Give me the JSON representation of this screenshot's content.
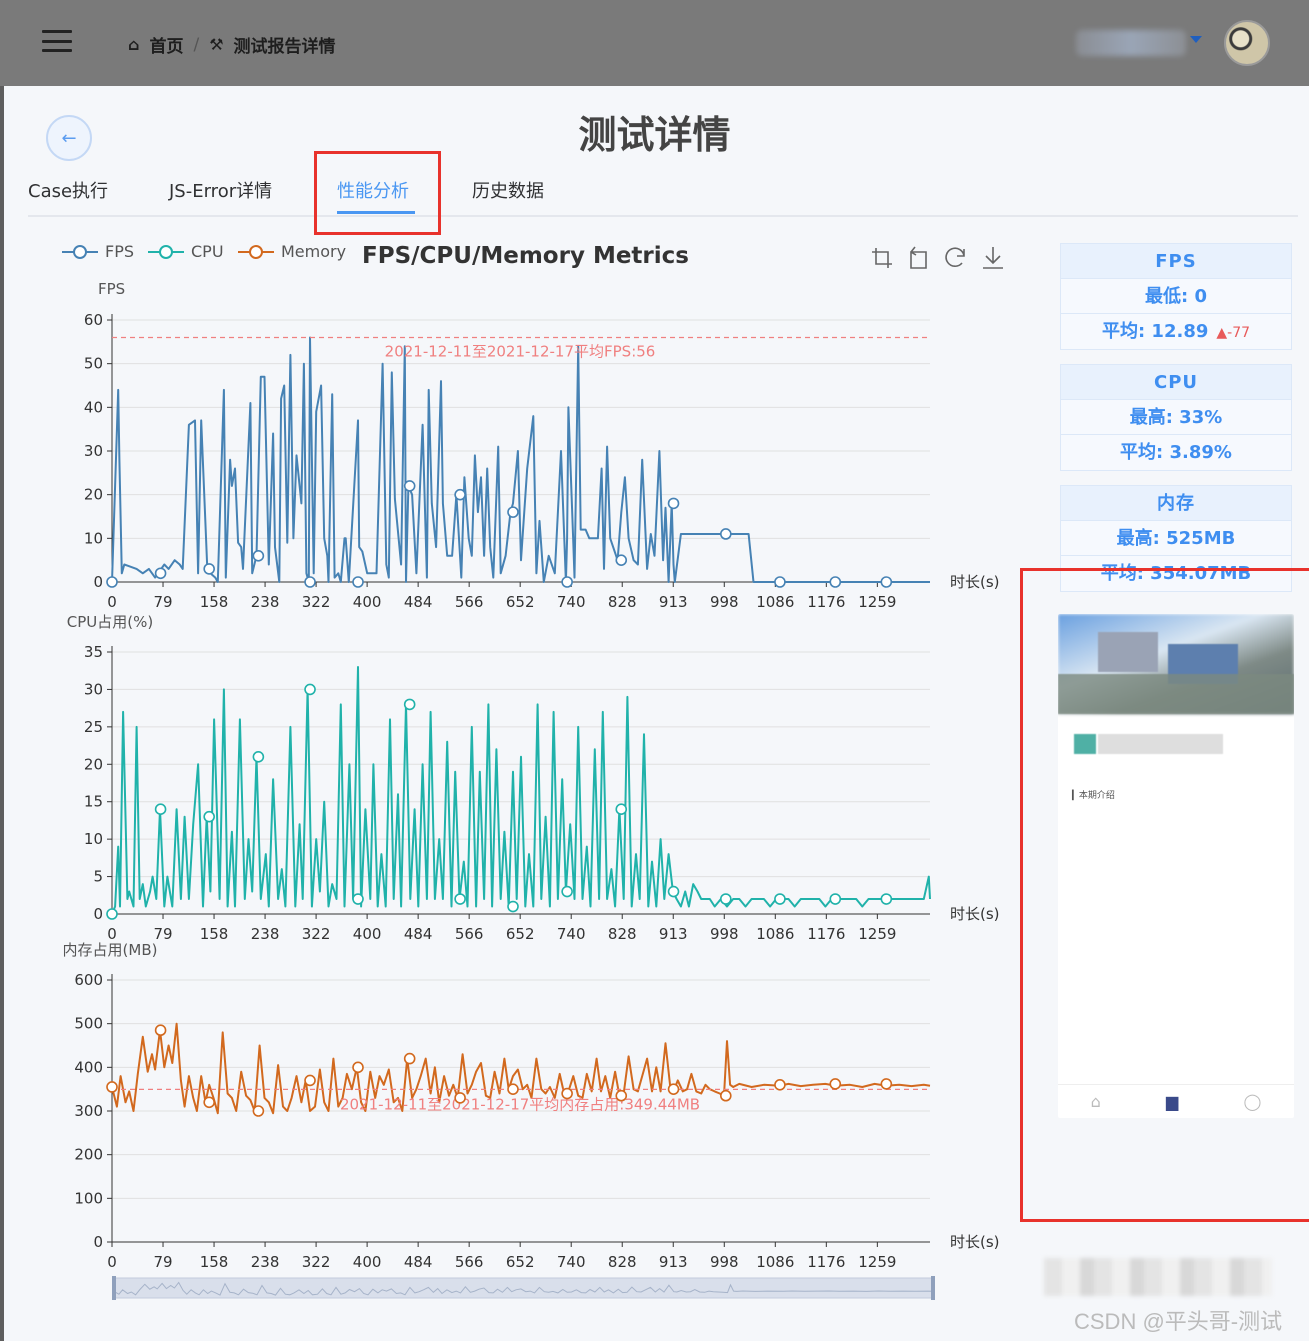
{
  "topbar": {
    "breadcrumbs": [
      {
        "icon": "home-icon",
        "glyph": "⌂",
        "label": "首页"
      },
      {
        "icon": "tools-icon",
        "glyph": "⚒",
        "label": "测试报告详情"
      }
    ],
    "separator": "/"
  },
  "page": {
    "back_glyph": "←",
    "title": "测试详情",
    "tabs": [
      "Case执行",
      "JS-Error详情",
      "性能分析",
      "历史数据"
    ],
    "active_tab": 2
  },
  "stats": {
    "fps": {
      "title": "FPS",
      "min": "最低: 0",
      "avg": "平均: 12.89",
      "trend": "▲-77"
    },
    "cpu": {
      "title": "CPU",
      "max": "最高: 33%",
      "avg": "平均: 3.89%"
    },
    "mem": {
      "title": "内存",
      "max": "最高: 525MB",
      "avg": "平均: 354.07MB"
    }
  },
  "preview": {
    "label": "▎本期介绍"
  },
  "watermark": "CSDN @平头哥-测试",
  "colors": {
    "fps": "#4682b4",
    "cpu": "#20b2aa",
    "mem": "#d2691e",
    "active": "#4a97f2",
    "highlight": "#e8322c",
    "avg_line": "#f08080"
  },
  "chart_data": {
    "type": "line",
    "title": "FPS/CPU/Memory Metrics",
    "legend": [
      "FPS",
      "CPU",
      "Memory"
    ],
    "legend_position": "top-left",
    "x_categories": [
      "0",
      "79",
      "158",
      "238",
      "322",
      "400",
      "484",
      "566",
      "652",
      "740",
      "828",
      "913",
      "998",
      "1086",
      "1176",
      "1259"
    ],
    "x_range": [
      0,
      1330
    ],
    "xlabel": "时长(s)",
    "panels": [
      {
        "name": "FPS",
        "ylabel": "FPS",
        "ylim": [
          0,
          60
        ],
        "yticks": [
          "0",
          "10",
          "20",
          "30",
          "40",
          "50",
          "60"
        ],
        "avg_value": 56,
        "avg_label": "2021-12-11至2021-12-17平均FPS:56",
        "x": [
          0,
          10,
          12,
          16,
          20,
          40,
          50,
          60,
          70,
          75,
          85,
          92,
          102,
          110,
          115,
          125,
          135,
          140,
          145,
          155,
          160,
          168,
          172,
          182,
          185,
          192,
          195,
          200,
          205,
          210,
          213,
          225,
          228,
          235,
          242,
          248,
          255,
          262,
          265,
          272,
          275,
          280,
          285,
          290,
          295,
          300,
          308,
          312,
          316,
          320,
          322,
          328,
          332,
          340,
          345,
          350,
          352,
          358,
          362,
          368,
          372,
          378,
          380,
          385,
          400,
          402,
          407,
          415,
          430,
          440,
          446,
          450,
          455,
          460,
          470,
          476,
          478,
          482,
          488,
          495,
          505,
          512,
          515,
          520,
          527,
          535,
          538,
          545,
          553,
          560,
          568,
          573,
          580,
          585,
          590,
          595,
          600,
          605,
          610,
          615,
          620,
          628,
          632,
          640,
          648,
          652,
          660,
          665,
          675,
          685,
          690,
          695,
          702,
          710,
          720,
          730,
          738,
          740,
          742,
          750,
          752,
          758,
          762,
          765,
          768,
          770,
          776,
          780,
          790,
          796,
          800,
          805,
          810,
          822,
          828,
          834,
          840,
          848,
          855,
          862,
          870,
          876,
          882,
          890,
          896,
          900,
          905,
          910,
          913,
          915,
          925,
          930,
          945,
          960,
          970,
          985,
          990,
          995,
          998,
          1000,
          1005,
          1010,
          1015,
          1025,
          1035,
          1043,
          1045,
          1086,
          1176,
          1259,
          1328,
          1330
        ],
        "y": [
          0,
          44,
          28,
          2,
          4,
          3,
          2,
          3,
          1,
          2,
          4,
          3,
          5,
          4,
          3,
          36,
          37,
          2,
          37,
          3,
          2,
          1,
          0,
          44,
          1,
          28,
          22,
          26,
          9,
          8,
          3,
          41,
          2,
          6,
          47,
          47,
          4,
          34,
          8,
          0,
          42,
          45,
          9,
          52,
          10,
          29,
          18,
          50,
          2,
          0,
          56,
          2,
          39,
          45,
          10,
          6,
          0,
          43,
          1,
          2,
          0,
          10,
          10,
          0,
          37,
          8,
          7,
          2,
          2,
          50,
          4,
          1,
          48,
          19,
          4,
          54,
          0,
          22,
          20,
          2,
          36,
          1,
          44,
          18,
          8,
          46,
          18,
          6,
          6,
          20,
          1,
          24,
          10,
          6,
          29,
          16,
          24,
          6,
          26,
          8,
          1,
          31,
          2,
          6,
          16,
          18,
          30,
          5,
          26,
          38,
          2,
          14,
          0,
          6,
          2,
          30,
          0,
          10,
          40,
          9,
          1,
          54,
          12,
          12,
          12,
          12,
          10,
          10,
          10,
          26,
          3,
          31,
          10,
          5,
          16,
          24,
          10,
          5,
          4,
          28,
          3,
          11,
          6,
          30,
          5,
          17,
          0,
          18,
          4,
          0,
          11,
          11,
          11,
          11,
          11,
          11,
          11,
          11,
          11,
          11,
          11,
          11,
          11,
          11,
          11,
          0
        ]
      },
      {
        "name": "CPU",
        "ylabel": "CPU占用(%)",
        "ylim": [
          0,
          35
        ],
        "yticks": [
          "0",
          "5",
          "10",
          "15",
          "20",
          "25",
          "30",
          "35"
        ],
        "x": [
          0,
          5,
          10,
          13,
          18,
          25,
          28,
          35,
          40,
          45,
          50,
          55,
          62,
          66,
          72,
          78,
          85,
          90,
          98,
          105,
          112,
          118,
          125,
          132,
          140,
          148,
          154,
          160,
          166,
          175,
          182,
          188,
          195,
          200,
          208,
          216,
          222,
          228,
          235,
          242,
          250,
          255,
          262,
          270,
          276,
          282,
          290,
          298,
          305,
          310,
          318,
          325,
          332,
          338,
          345,
          352,
          358,
          365,
          372,
          378,
          386,
          392,
          400,
          405,
          412,
          420,
          425,
          432,
          438,
          445,
          452,
          458,
          465,
          470,
          478,
          485,
          492,
          498,
          505,
          512,
          518,
          525,
          532,
          538,
          545,
          552,
          558,
          565,
          572,
          578,
          585,
          592,
          598,
          605,
          612,
          618,
          625,
          632,
          638,
          645,
          652,
          658,
          665,
          672,
          678,
          685,
          692,
          698,
          705,
          712,
          718,
          725,
          732,
          738,
          745,
          752,
          758,
          765,
          772,
          778,
          785,
          792,
          798,
          805,
          812,
          818,
          825,
          832,
          838,
          845,
          852,
          858,
          865,
          872,
          878,
          885,
          892,
          898,
          905,
          912,
          918,
          925,
          932,
          938,
          945,
          952,
          958,
          965,
          972,
          980,
          990,
          1000,
          1010,
          1020,
          1030,
          1040,
          1050,
          1060,
          1070,
          1080,
          1090,
          1100,
          1110,
          1120,
          1130,
          1140,
          1150,
          1160,
          1170,
          1180,
          1190,
          1200,
          1210,
          1220,
          1230,
          1240,
          1250,
          1260,
          1270,
          1280,
          1290,
          1300,
          1310,
          1320,
          1328,
          1330
        ],
        "y": [
          0,
          1,
          9,
          1,
          27,
          2,
          3,
          1,
          25,
          2,
          4,
          1,
          3,
          5,
          2,
          14,
          1,
          5,
          1,
          14,
          2,
          13,
          2,
          12,
          20,
          1,
          13,
          3,
          26,
          2,
          30,
          1,
          11,
          1,
          26,
          2,
          10,
          3,
          21,
          2,
          8,
          1,
          18,
          2,
          6,
          1,
          25,
          1,
          12,
          2,
          30,
          1,
          10,
          3,
          15,
          1,
          4,
          2,
          28,
          1,
          20,
          2,
          33,
          1,
          14,
          2,
          20,
          1,
          8,
          1,
          26,
          2,
          16,
          1,
          28,
          2,
          14,
          1,
          20,
          2,
          27,
          2,
          10,
          2,
          23,
          1,
          19,
          2,
          7,
          1,
          25,
          1,
          19,
          2,
          28,
          1,
          22,
          2,
          11,
          1,
          19,
          2,
          21,
          1,
          8,
          1,
          28,
          2,
          13,
          1,
          27,
          2,
          18,
          3,
          12,
          2,
          25,
          2,
          9,
          1,
          22,
          2,
          27,
          2,
          6,
          1,
          14,
          2,
          29,
          1,
          8,
          2,
          24,
          1,
          7,
          1,
          10,
          2,
          8,
          3,
          2,
          1,
          3,
          1,
          4,
          3,
          2,
          2,
          2,
          1,
          2,
          1,
          2,
          2,
          1,
          2,
          2,
          2,
          1,
          2,
          2,
          2,
          1,
          2,
          2,
          2,
          2,
          1,
          2,
          2,
          2,
          2,
          2,
          1,
          2,
          2,
          2,
          2,
          2,
          2,
          2,
          2,
          2,
          2,
          5,
          2
        ]
      },
      {
        "name": "Memory",
        "ylabel": "内存占用(MB)",
        "ylim": [
          0,
          600
        ],
        "yticks": [
          "0",
          "100",
          "200",
          "300",
          "400",
          "500",
          "600"
        ],
        "avg_value": 349.44,
        "avg_label": "2021-12-11至2021-12-17平均内存占用:349.44MB",
        "x": [
          0,
          8,
          14,
          22,
          28,
          35,
          42,
          50,
          58,
          65,
          70,
          78,
          85,
          92,
          98,
          105,
          112,
          118,
          125,
          132,
          138,
          145,
          152,
          158,
          165,
          172,
          180,
          188,
          195,
          202,
          210,
          218,
          225,
          232,
          240,
          248,
          255,
          262,
          270,
          278,
          285,
          292,
          300,
          308,
          315,
          322,
          330,
          338,
          345,
          352,
          360,
          368,
          375,
          382,
          390,
          398,
          405,
          412,
          420,
          428,
          435,
          442,
          450,
          458,
          465,
          472,
          480,
          488,
          495,
          502,
          510,
          518,
          525,
          532,
          540,
          548,
          555,
          562,
          570,
          578,
          585,
          592,
          600,
          608,
          615,
          622,
          630,
          638,
          645,
          652,
          660,
          668,
          675,
          682,
          690,
          698,
          705,
          712,
          720,
          728,
          735,
          742,
          750,
          758,
          765,
          772,
          780,
          788,
          795,
          802,
          810,
          818,
          825,
          832,
          840,
          848,
          855,
          862,
          870,
          878,
          885,
          892,
          900,
          908,
          913,
          920,
          928,
          935,
          942,
          950,
          958,
          965,
          972,
          980,
          988,
          995,
          1000,
          1005,
          1010,
          1020,
          1040,
          1060,
          1086,
          1100,
          1120,
          1140,
          1160,
          1176,
          1200,
          1220,
          1240,
          1259,
          1280,
          1300,
          1320,
          1330
        ],
        "y": [
          355,
          310,
          380,
          320,
          345,
          300,
          385,
          470,
          390,
          430,
          395,
          485,
          400,
          450,
          410,
          500,
          370,
          310,
          380,
          330,
          300,
          380,
          320,
          360,
          330,
          295,
          480,
          340,
          330,
          300,
          390,
          335,
          325,
          300,
          450,
          330,
          320,
          295,
          405,
          310,
          300,
          330,
          380,
          320,
          370,
          300,
          310,
          395,
          320,
          300,
          420,
          310,
          330,
          385,
          350,
          400,
          320,
          300,
          390,
          330,
          380,
          360,
          395,
          320,
          330,
          300,
          420,
          330,
          350,
          380,
          420,
          340,
          400,
          320,
          380,
          335,
          360,
          330,
          430,
          340,
          360,
          390,
          410,
          335,
          330,
          390,
          340,
          420,
          350,
          380,
          395,
          350,
          360,
          330,
          420,
          350,
          340,
          355,
          330,
          385,
          340,
          345,
          380,
          335,
          330,
          385,
          345,
          420,
          345,
          380,
          330,
          390,
          335,
          340,
          425,
          350,
          345,
          380,
          420,
          345,
          400,
          345,
          455,
          350,
          345,
          370,
          345,
          350,
          385,
          345,
          340,
          360,
          350,
          345,
          340,
          335,
          460,
          360,
          355,
          362,
          355,
          360,
          358,
          362,
          357,
          360,
          362,
          358,
          360,
          355,
          362,
          358,
          360,
          357,
          360,
          358
        ]
      }
    ]
  }
}
